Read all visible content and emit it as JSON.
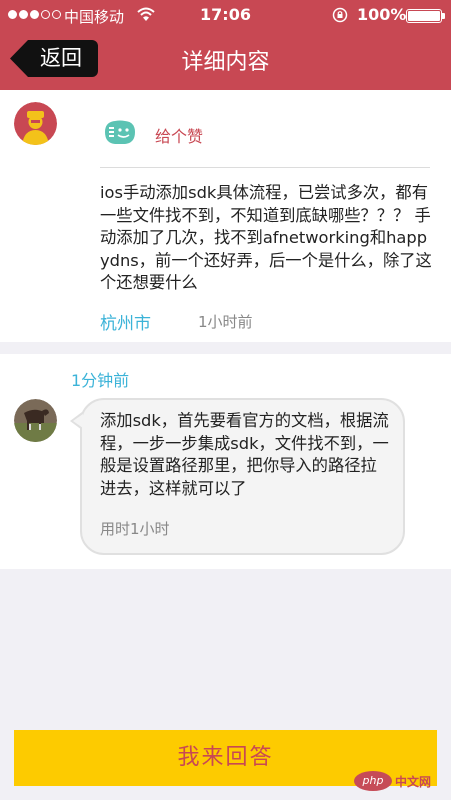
{
  "status_bar": {
    "carrier": "中国移动",
    "time": "17:06",
    "battery": "100%"
  },
  "nav": {
    "back_label": "返回",
    "title": "详细内容"
  },
  "question": {
    "like_label": "给个赞",
    "text": "ios手动添加sdk具体流程，已尝试多次，都有一些文件找不到，不知道到底缺哪些？？？ 手动添加了几次，找不到afnetworking和happydns，前一个还好弄，后一个是什么，除了这个还想要什么",
    "location": "杭州市",
    "time": "1小时前"
  },
  "answer": {
    "time": "1分钟前",
    "text": "添加sdk，首先要看官方的文档，根据流程，一步一步集成sdk，文件找不到，一般是设置路径那里，把你导入的路径拉进去，这样就可以了",
    "duration": "用时1小时"
  },
  "footer": {
    "answer_button": "我来回答"
  },
  "watermark": {
    "logo": "php",
    "text": "中文网"
  },
  "colors": {
    "brand": "#c84853",
    "accent_blue": "#3bb3d8",
    "button_yellow": "#fdcb00"
  }
}
